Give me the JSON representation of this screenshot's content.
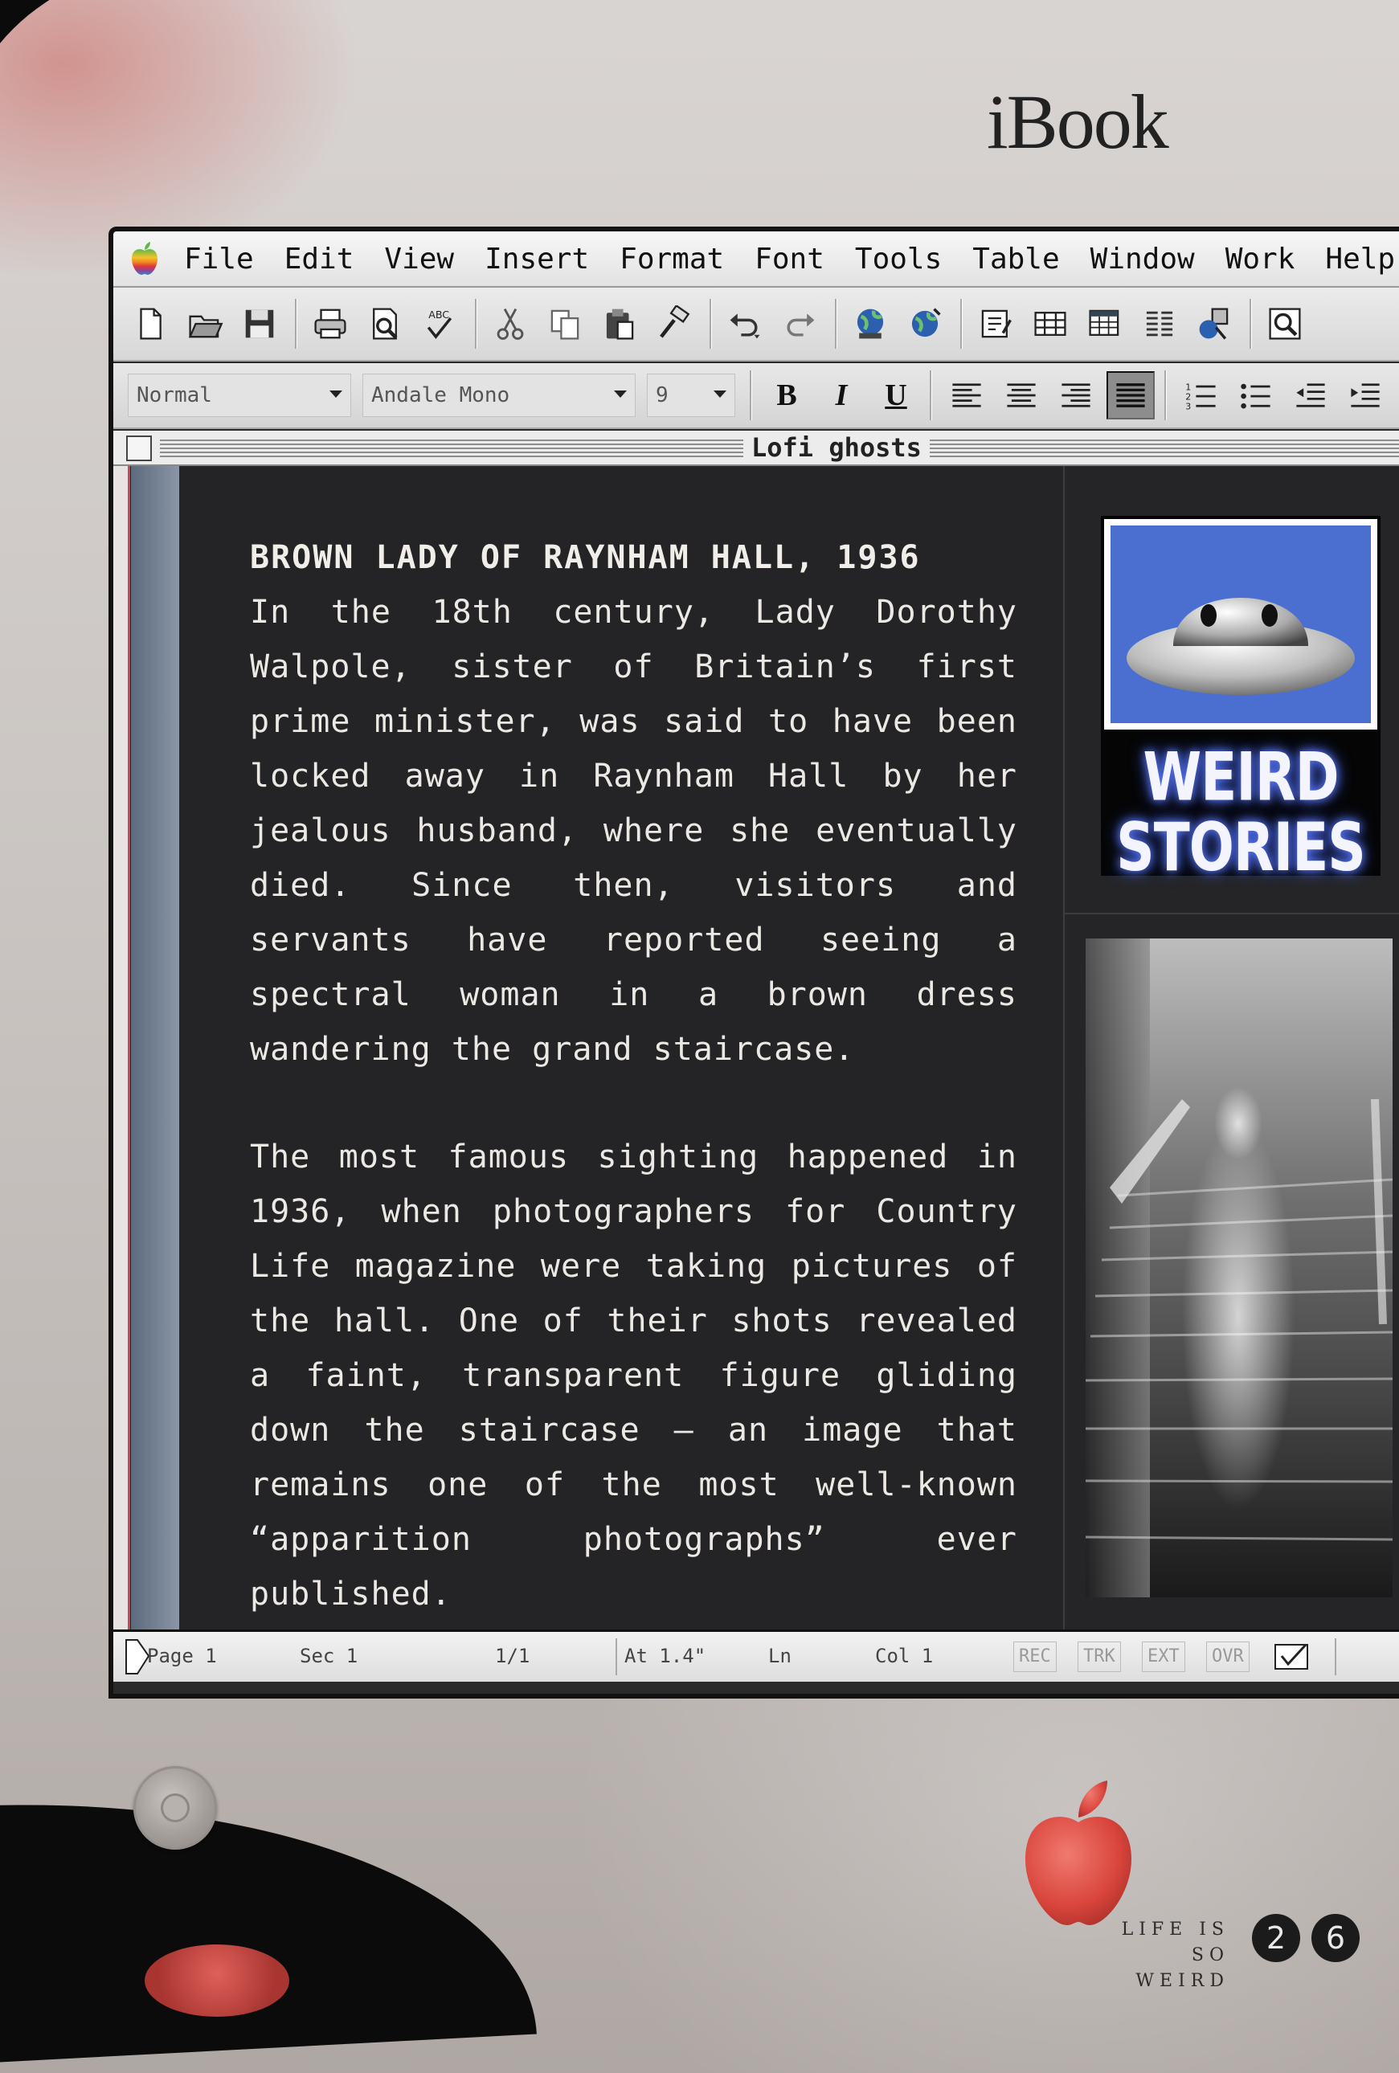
{
  "device": {
    "brand": "iBook"
  },
  "menubar": {
    "items": [
      "File",
      "Edit",
      "View",
      "Insert",
      "Format",
      "Font",
      "Tools",
      "Table",
      "Window",
      "Work",
      "Help"
    ]
  },
  "toolbar": {
    "icons": [
      "new-document-icon",
      "open-folder-icon",
      "save-icon",
      "print-icon",
      "print-preview-icon",
      "spelling-check-icon",
      "cut-icon",
      "copy-icon",
      "paste-icon",
      "format-painter-icon",
      "undo-icon",
      "redo-icon",
      "web-globe-icon",
      "web-toolbar-icon",
      "text-box-icon",
      "insert-table-icon",
      "insert-worksheet-icon",
      "columns-icon",
      "drawing-icon",
      "zoom-icon"
    ]
  },
  "formatbar": {
    "style": "Normal",
    "font": "Andale Mono",
    "size": "9",
    "bold": "B",
    "italic": "I",
    "underline": "U"
  },
  "window": {
    "title": "Lofi ghosts"
  },
  "article": {
    "heading": "BROWN LADY OF RAYNHAM HALL, 1936",
    "paragraphs": [
      "In the 18th century, Lady Dorothy Walpole, sister of Britain’s first prime minister, was said to have been locked away in Raynham Hall by her jealous husband, where she eventually died. Since then, visitors and servants have reported seeing a spectral woman in a brown dress wandering the grand staircase.",
      "The most famous sighting happened in 1936, when photographers for Country Life magazine were taking pictures of the hall. One of their shots revealed a faint, transparent figure gliding down the staircase – an image that remains one of the most well-known “apparition photographs” ever published."
    ]
  },
  "badge": {
    "line1": "WEIRD",
    "line2": "STORIES"
  },
  "statusbar": {
    "page": "Page 1",
    "section": "Sec 1",
    "pages": "1/1",
    "at": "At 1.4\"",
    "line": "Ln",
    "col": "Col 1",
    "rec": "REC",
    "trk": "TRK",
    "ext": "EXT",
    "ovr": "OVR"
  },
  "footer": {
    "line1": "LIFE IS",
    "line2": "SO WEIRD",
    "page_digit_1": "2",
    "page_digit_2": "6"
  },
  "colors": {
    "apple_red": "#d9453c",
    "badge_blue": "#4a6fd0",
    "screen_bg": "#252528"
  }
}
